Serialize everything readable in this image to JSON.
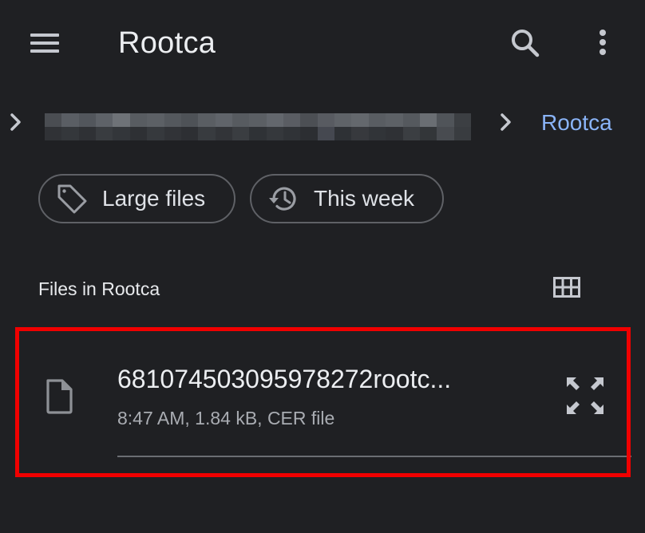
{
  "appbar": {
    "title": "Rootca",
    "menu_icon": "hamburger-menu-icon",
    "search_icon": "search-icon",
    "more_icon": "more-vert-icon"
  },
  "breadcrumb": {
    "parent_path_redacted": true,
    "current": "Rootca",
    "separator_icon": "chevron-right-icon",
    "current_color": "#8ab4f8"
  },
  "filters": {
    "chips": [
      {
        "label": "Large files",
        "icon": "tag-icon"
      },
      {
        "label": "This week",
        "icon": "history-icon"
      }
    ]
  },
  "section": {
    "title": "Files in Rootca",
    "view_toggle_icon": "grid-view-icon"
  },
  "files": [
    {
      "name": "68107450309597827 2rootc...",
      "display_name": "681074503095978272rootc...",
      "meta": "8:47 AM, 1.84 kB, CER file",
      "icon": "file-icon",
      "action_icon": "expand-icon"
    }
  ],
  "highlight": {
    "color": "#f00000"
  },
  "colors": {
    "background": "#1f2023",
    "text_primary": "#eceef1",
    "text_secondary": "#a9acb2",
    "accent": "#8ab4f8"
  }
}
